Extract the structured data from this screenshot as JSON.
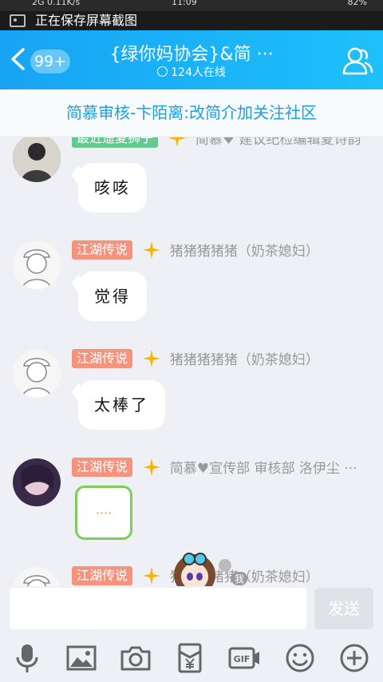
{
  "status": {
    "signal": "2G",
    "speed": "0.11K/s",
    "time": "11:09",
    "battery": "82%"
  },
  "notification": {
    "text": "正在保存屏幕截图"
  },
  "header": {
    "back_badge": "99+",
    "title": "{绿你妈协会}&简 ···",
    "online": "124人在线"
  },
  "announcement": "简慕审核-卞陌离:改简介加关注社区",
  "messages": [
    {
      "tag": "最近遥夏狮子",
      "tag_color": "#63c98c",
      "name": "简慕♥ 建议纪检编辑夏诗韵",
      "text": "咳咳"
    },
    {
      "tag": "江湖传说",
      "tag_color": "#f6937c",
      "name": "猪猪猪猪猪（奶茶媳妇）",
      "text": "觉得"
    },
    {
      "tag": "江湖传说",
      "tag_color": "#f6937c",
      "name": "猪猪猪猪猪（奶茶媳妇）",
      "text": "太棒了"
    },
    {
      "tag": "江湖传说",
      "tag_color": "#f6937c",
      "name": "简慕♥宣传部 审核部 洛伊尘 ···",
      "text": "····"
    },
    {
      "tag": "江湖传说",
      "tag_color": "#f6937c",
      "name": "猪猪猪猪猪（奶茶媳妇）",
      "text": ""
    }
  ],
  "sticker_label": "我",
  "input": {
    "value": "",
    "placeholder": ""
  },
  "send_label": "发送",
  "toolbar_icons": [
    "microphone-icon",
    "image-icon",
    "camera-icon",
    "red-packet-icon",
    "gif-icon",
    "emoji-icon",
    "plus-icon"
  ],
  "colors": {
    "header_start": "#17a4f4",
    "header_end": "#1ec0fb",
    "announcement_text": "#1aa0e0",
    "tag_green": "#63c98c",
    "tag_orange": "#f6937c"
  }
}
